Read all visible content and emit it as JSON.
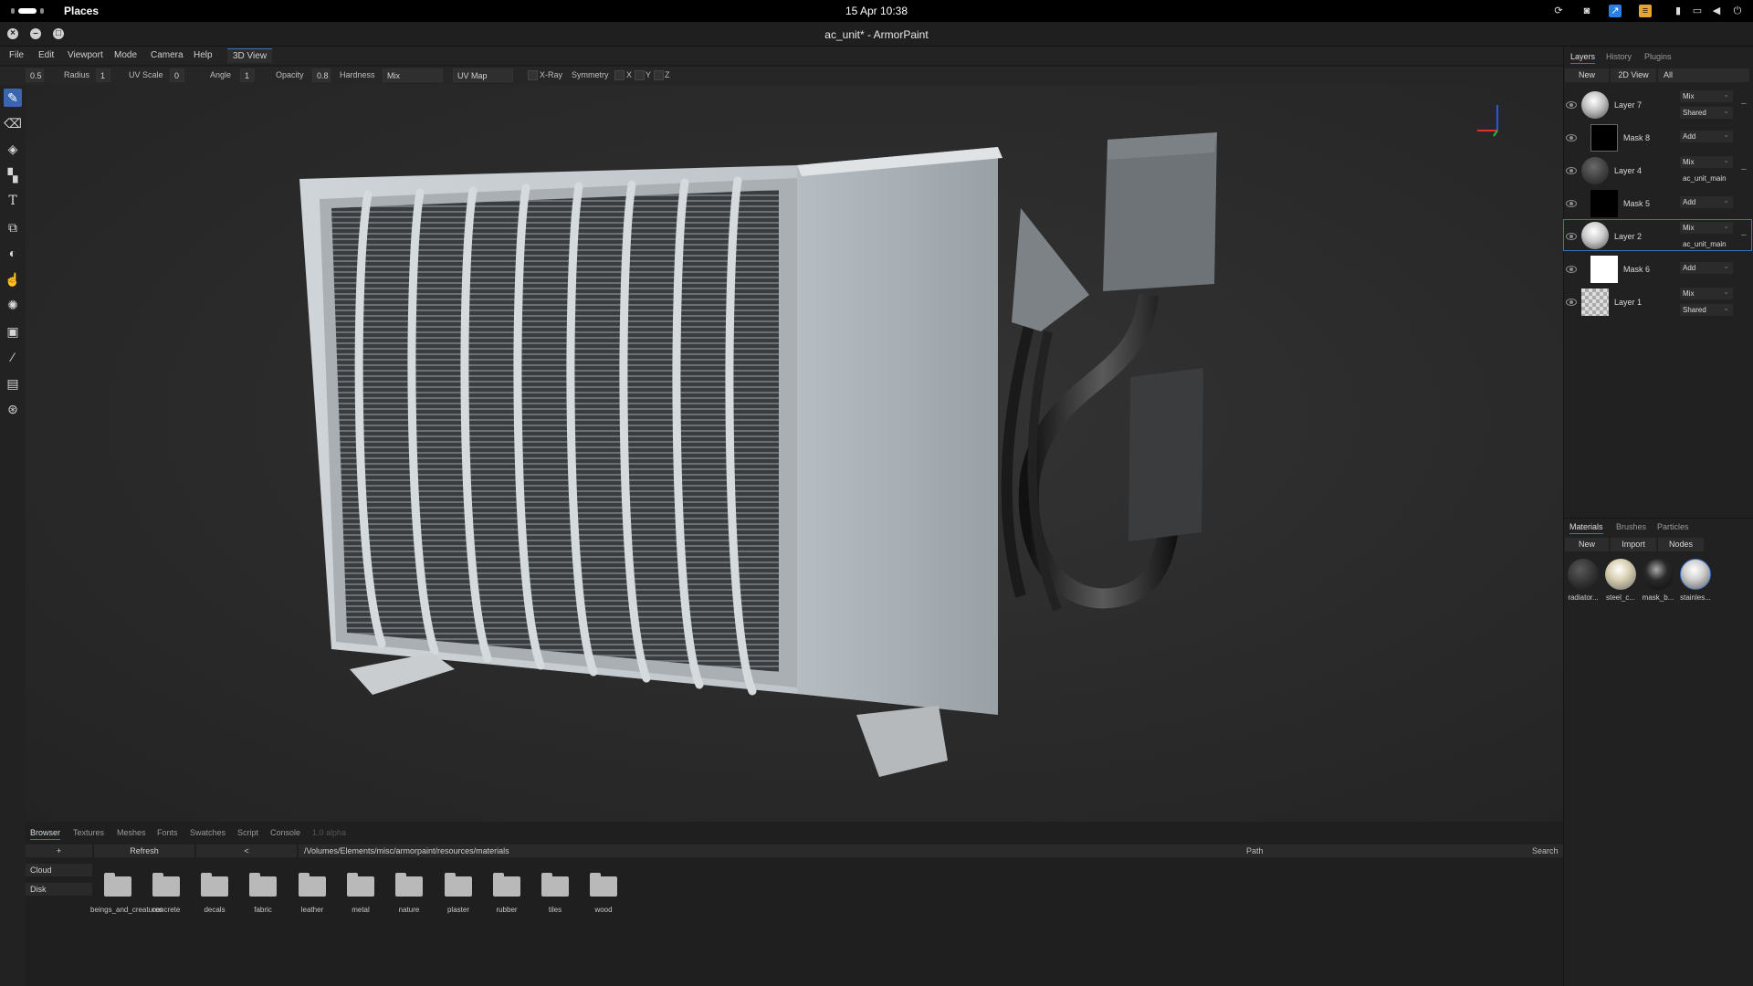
{
  "system": {
    "places": "Places",
    "clock": "15 Apr 10:38",
    "tray_icons": [
      "steam-icon",
      "discord-icon",
      "app-icon",
      "notes-icon",
      "clipboard-icon",
      "mail-icon",
      "volume-icon",
      "power-icon"
    ]
  },
  "window": {
    "title": "ac_unit* - ArmorPaint"
  },
  "menu": {
    "items": [
      "File",
      "Edit",
      "Viewport",
      "Mode",
      "Camera",
      "Help"
    ],
    "active": "3D View"
  },
  "options": {
    "strength": "0.5",
    "radius_label": "Radius",
    "radius": "1",
    "uvscale_label": "UV Scale",
    "uvscale": "0",
    "angle_label": "Angle",
    "angle": "1",
    "opacity_label": "Opacity",
    "opacity": "0.8",
    "hardness_label": "Hardness",
    "blend": "Mix",
    "uvmap": "UV Map",
    "xray": "X-Ray",
    "symmetry": "Symmetry",
    "x": "X",
    "y": "Y",
    "z": "Z"
  },
  "tools": [
    "brush-icon",
    "eraser-icon",
    "fill-icon",
    "decal-icon",
    "text-icon",
    "clone-icon",
    "blur-icon",
    "smudge-icon",
    "particle-icon",
    "colorid-icon",
    "picker-icon",
    "bake-icon",
    "material-icon"
  ],
  "browser": {
    "tabs": [
      "Browser",
      "Textures",
      "Meshes",
      "Fonts",
      "Swatches",
      "Script",
      "Console",
      "1.0 alpha"
    ],
    "add": "+",
    "refresh": "Refresh",
    "back": "<",
    "path": "/Volumes/Elements/misc/armorpaint/resources/materials",
    "path_label": "Path",
    "search_label": "Search",
    "sources": [
      "Cloud",
      "Disk"
    ],
    "folders": [
      "beings_and_creatures",
      "concrete",
      "decals",
      "fabric",
      "leather",
      "metal",
      "nature",
      "plaster",
      "rubber",
      "tiles",
      "wood"
    ]
  },
  "layers_panel": {
    "tabs": [
      "Layers",
      "History",
      "Plugins"
    ],
    "new": "New",
    "view2d": "2D View",
    "filter": "All",
    "rows": [
      {
        "name": "Layer 7",
        "blend": "Mix",
        "target": "Shared",
        "kind": "layer"
      },
      {
        "name": "Mask 8",
        "blend": "Add",
        "kind": "mask"
      },
      {
        "name": "Layer 4",
        "blend": "Mix",
        "target": "ac_unit_main",
        "kind": "layer"
      },
      {
        "name": "Mask 5",
        "blend": "Add",
        "kind": "mask"
      },
      {
        "name": "Layer 2",
        "blend": "Mix",
        "target": "ac_unit_main",
        "kind": "layer",
        "selected": true
      },
      {
        "name": "Mask 6",
        "blend": "Add",
        "kind": "mask"
      },
      {
        "name": "Layer 1",
        "blend": "Mix",
        "target": "Shared",
        "kind": "layer"
      }
    ]
  },
  "materials_panel": {
    "tabs": [
      "Materials",
      "Brushes",
      "Particles"
    ],
    "buttons": [
      "New",
      "Import",
      "Nodes"
    ],
    "materials": [
      "radiator...",
      "steel_c...",
      "mask_b...",
      "stainles..."
    ]
  },
  "colors": {
    "accent": "#3a6fc4",
    "background": "#1c1c1c"
  }
}
